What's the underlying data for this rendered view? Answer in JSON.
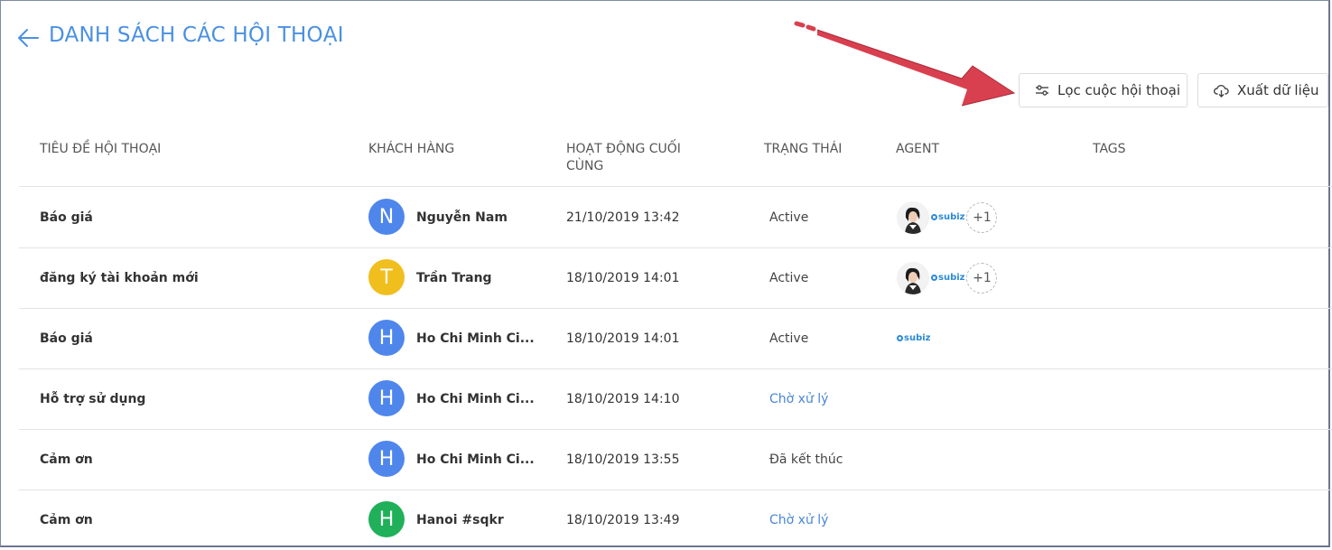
{
  "page": {
    "title": "DANH SÁCH CÁC HỘI THOẠI"
  },
  "toolbar": {
    "filter_label": "Lọc cuộc hội thoại",
    "export_label": "Xuất dữ liệu"
  },
  "table": {
    "columns": [
      "TIÊU ĐỀ HỘI THOẠI",
      "KHÁCH HÀNG",
      "HOẠT ĐỘNG CUỐI CÙNG",
      "TRẠNG THÁI",
      "AGENT",
      "TAGS"
    ],
    "rows": [
      {
        "title": "Báo giá",
        "initial": "N",
        "avatar_color": "#4f86ec",
        "customer": "Nguyễn Nam",
        "last_activity": "21/10/2019 13:42",
        "status": "Active",
        "agent_brand": "subiz",
        "agent_more": "+1"
      },
      {
        "title": "đăng ký tài khoản mới",
        "initial": "T",
        "avatar_color": "#f0bf1e",
        "customer": "Trần Trang",
        "last_activity": "18/10/2019 14:01",
        "status": "Active",
        "agent_brand": "subiz",
        "agent_more": "+1"
      },
      {
        "title": "Báo giá",
        "initial": "H",
        "avatar_color": "#4f86ec",
        "customer": "Ho Chi Minh Ci...",
        "last_activity": "18/10/2019 14:01",
        "status": "Active",
        "agent_brand": "subiz",
        "agent_more": ""
      },
      {
        "title": "Hỗ trợ sử dụng",
        "initial": "H",
        "avatar_color": "#4f86ec",
        "customer": "Ho Chi Minh Ci...",
        "last_activity": "18/10/2019 14:10",
        "status": "Chờ xử lý",
        "agent_brand": "",
        "agent_more": ""
      },
      {
        "title": "Cảm ơn",
        "initial": "H",
        "avatar_color": "#4f86ec",
        "customer": "Ho Chi Minh Ci...",
        "last_activity": "18/10/2019 13:55",
        "status": "Đã kết thúc",
        "agent_brand": "",
        "agent_more": ""
      },
      {
        "title": "Cảm ơn",
        "initial": "H",
        "avatar_color": "#20b05a",
        "customer": "Hanoi #sqkr",
        "last_activity": "18/10/2019 13:49",
        "status": "Chờ xử lý",
        "agent_brand": "",
        "agent_more": ""
      }
    ]
  },
  "colors": {
    "accent": "#4a90e2",
    "pending": "#4a86d8",
    "arrow": "#d9404f"
  }
}
